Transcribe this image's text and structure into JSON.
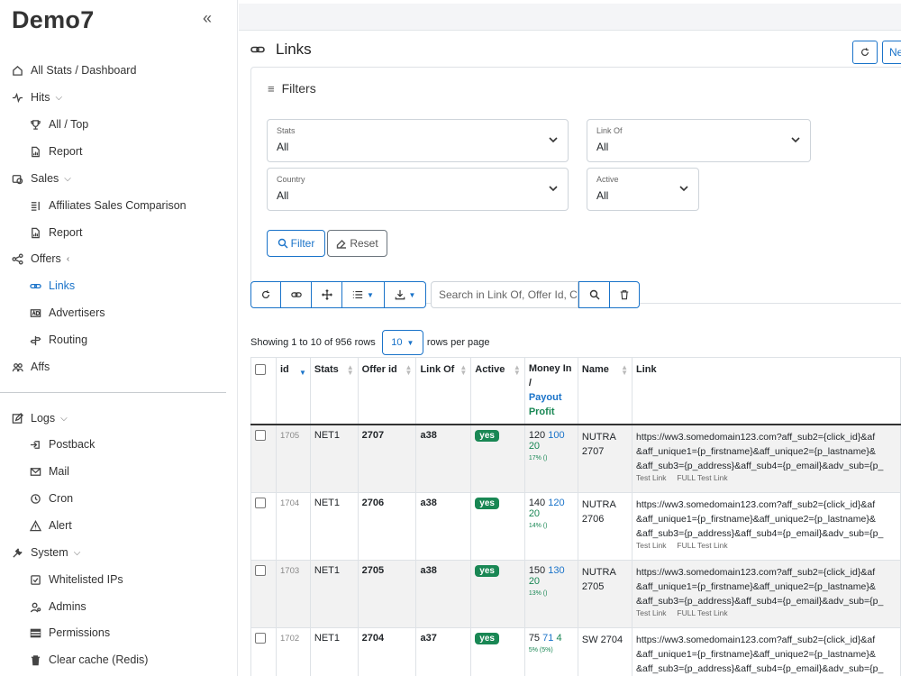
{
  "brand": "Demo7",
  "sidebar": {
    "items": [
      {
        "label": "All Stats / Dashboard"
      },
      {
        "label": "Hits"
      },
      {
        "label": "All / Top"
      },
      {
        "label": "Report"
      },
      {
        "label": "Sales"
      },
      {
        "label": "Affiliates Sales Comparison"
      },
      {
        "label": "Report"
      },
      {
        "label": "Offers"
      },
      {
        "label": "Links"
      },
      {
        "label": "Advertisers"
      },
      {
        "label": "Routing"
      },
      {
        "label": "Affs"
      },
      {
        "label": "Logs"
      },
      {
        "label": "Postback"
      },
      {
        "label": "Mail"
      },
      {
        "label": "Cron"
      },
      {
        "label": "Alert"
      },
      {
        "label": "System"
      },
      {
        "label": "Whitelisted IPs"
      },
      {
        "label": "Admins"
      },
      {
        "label": "Permissions"
      },
      {
        "label": "Clear cache (Redis)"
      }
    ]
  },
  "page": {
    "title": "Links",
    "new_label": "Ne"
  },
  "filters": {
    "title": "Filters",
    "stats": {
      "label": "Stats",
      "value": "All"
    },
    "link_of": {
      "label": "Link Of",
      "value": "All"
    },
    "country": {
      "label": "Country",
      "value": "All"
    },
    "active": {
      "label": "Active",
      "value": "All"
    },
    "filter_btn": "Filter",
    "reset_btn": "Reset"
  },
  "search": {
    "placeholder": "Search in Link Of, Offer Id, C"
  },
  "pagination": {
    "showing": "Showing 1 to 10 of 956 rows",
    "per_page": "10",
    "per_page_suffix": "rows per page"
  },
  "table": {
    "headers": {
      "id": "id",
      "stats": "Stats",
      "offer_id": "Offer id",
      "link_of": "Link Of",
      "active": "Active",
      "money_in": "Money In /",
      "payout": "Payout",
      "profit": "Profit",
      "name": "Name",
      "link": "Link"
    },
    "rows": [
      {
        "id": "1705",
        "stats": "NET1",
        "offer_id": "2707",
        "link_of": "a38",
        "active": "yes",
        "in": "120",
        "payout": "100",
        "profit": "20",
        "pct": "17% ()",
        "name1": "NUTRA",
        "name2": "2707",
        "l1": "https://ww3.somedomain123.com?aff_sub2={click_id}&af",
        "l2": "&aff_unique1={p_firstname}&aff_unique2={p_lastname}&",
        "l3": "&aff_sub3={p_address}&aff_sub4={p_email}&adv_sub={p_",
        "t1": "Test Link",
        "t2": "FULL Test Link"
      },
      {
        "id": "1704",
        "stats": "NET1",
        "offer_id": "2706",
        "link_of": "a38",
        "active": "yes",
        "in": "140",
        "payout": "120",
        "profit": "20",
        "pct": "14% ()",
        "name1": "NUTRA",
        "name2": "2706",
        "l1": "https://ww3.somedomain123.com?aff_sub2={click_id}&af",
        "l2": "&aff_unique1={p_firstname}&aff_unique2={p_lastname}&",
        "l3": "&aff_sub3={p_address}&aff_sub4={p_email}&adv_sub={p_",
        "t1": "Test Link",
        "t2": "FULL Test Link"
      },
      {
        "id": "1703",
        "stats": "NET1",
        "offer_id": "2705",
        "link_of": "a38",
        "active": "yes",
        "in": "150",
        "payout": "130",
        "profit": "20",
        "pct": "13% ()",
        "name1": "NUTRA",
        "name2": "2705",
        "l1": "https://ww3.somedomain123.com?aff_sub2={click_id}&af",
        "l2": "&aff_unique1={p_firstname}&aff_unique2={p_lastname}&",
        "l3": "&aff_sub3={p_address}&aff_sub4={p_email}&adv_sub={p_",
        "t1": "Test Link",
        "t2": "FULL Test Link"
      },
      {
        "id": "1702",
        "stats": "NET1",
        "offer_id": "2704",
        "link_of": "a37",
        "active": "yes",
        "in": "75",
        "payout": "71",
        "profit": "4",
        "pct": "5% (5%)",
        "name1": "SW 2704",
        "name2": "",
        "l1": "https://ww3.somedomain123.com?aff_sub2={click_id}&af",
        "l2": "&aff_unique1={p_firstname}&aff_unique2={p_lastname}&",
        "l3": "&aff_sub3={p_address}&aff_sub4={p_email}&adv_sub={p_",
        "t1": "Test Link",
        "t2": "FULL Test Link"
      }
    ]
  },
  "colors": {
    "accent": "#1a73c9",
    "success": "#198754"
  }
}
